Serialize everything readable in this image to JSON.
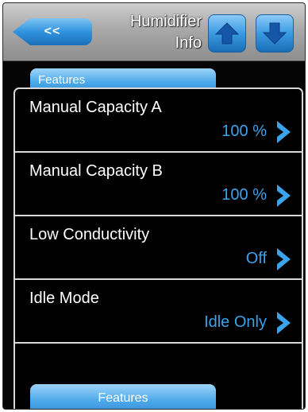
{
  "header": {
    "back_label": "<<",
    "title_line1": "Humidifier",
    "title_line2": "Info"
  },
  "tabs": {
    "top_label": "Features",
    "bottom_label": "Features"
  },
  "items": [
    {
      "label": "Manual Capacity A",
      "value": "100 %"
    },
    {
      "label": "Manual Capacity B",
      "value": "100 %"
    },
    {
      "label": "Low Conductivity",
      "value": "Off"
    },
    {
      "label": "Idle Mode",
      "value": "Idle Only"
    }
  ],
  "icons": {
    "up": "arrow-up-icon",
    "down": "arrow-down-icon",
    "row_arrow": "chevron-right-icon"
  },
  "colors": {
    "accent": "#3aa3ea",
    "background": "#050505",
    "header": "#a9a9a9"
  }
}
